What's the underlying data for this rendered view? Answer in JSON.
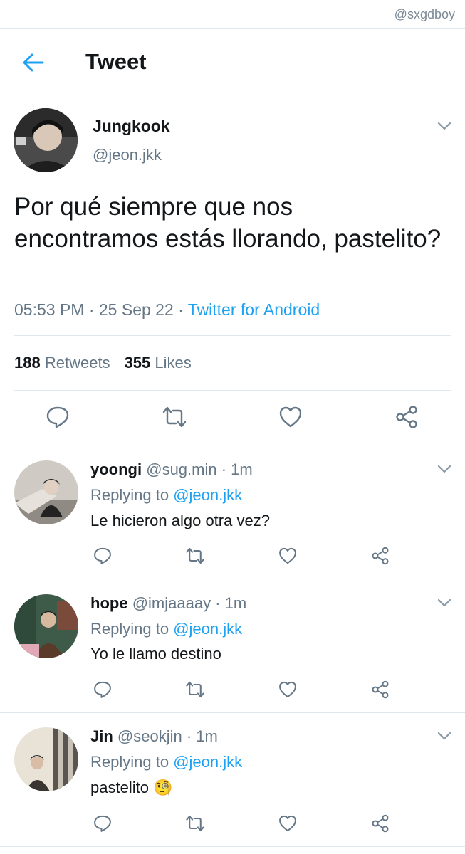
{
  "watermark": "@sxgdboy",
  "header": {
    "title": "Tweet"
  },
  "tweet": {
    "author_name": "Jungkook",
    "author_handle": "@jeon.jkk",
    "text": "Por qué siempre que nos encontramos estás llorando, pastelito?",
    "time": "05:53 PM · 25 Sep 22 · ",
    "source": "Twitter for Android",
    "retweets_count": "188",
    "retweets_label": "Retweets",
    "likes_count": "355",
    "likes_label": "Likes"
  },
  "replies": [
    {
      "name": "yoongi",
      "rest": "@sug.min · 1m",
      "replying_prefix": "Replying to ",
      "mention": "@jeon.jkk",
      "text": "Le hicieron algo otra vez?"
    },
    {
      "name": "hope",
      "rest": "@imjaaaay · 1m",
      "replying_prefix": "Replying to ",
      "mention": "@jeon.jkk",
      "text": "Yo le llamo destino"
    },
    {
      "name": "Jin",
      "rest": "@seokjin · 1m",
      "replying_prefix": "Replying to ",
      "mention": "@jeon.jkk",
      "text": "pastelito 🧐"
    }
  ],
  "icons": {
    "back": "arrow-left-icon",
    "reply": "reply-icon",
    "retweet": "retweet-icon",
    "like": "heart-icon",
    "share": "share-icon",
    "more": "chevron-down-icon"
  },
  "colors": {
    "accent": "#1da1f2",
    "secondary_text": "#657786",
    "divider": "#e1e8ed"
  }
}
